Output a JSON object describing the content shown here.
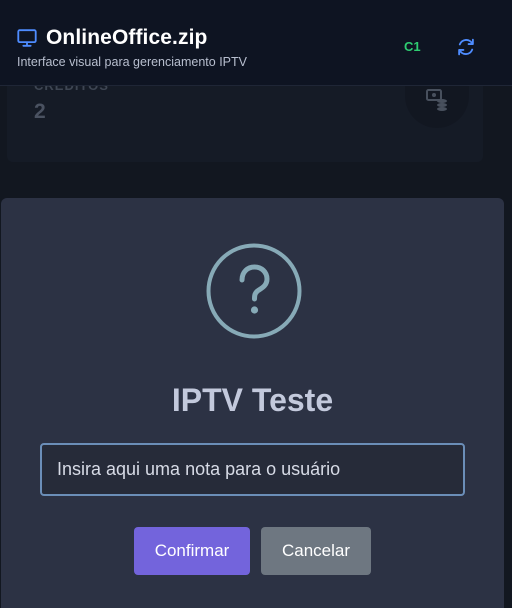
{
  "header": {
    "title": "OnlineOffice.zip",
    "subtitle": "Interface visual para gerenciamento IPTV",
    "server_badge": "C1",
    "icons": {
      "brand": "monitor-icon",
      "refresh": "refresh-icon"
    },
    "colors": {
      "background": "#0e1422",
      "badge": "#2ecc71",
      "refresh": "#4e8cff"
    }
  },
  "stat_card": {
    "label": "CRÉDITOS",
    "value": "2",
    "icon": "coins-icon"
  },
  "modal": {
    "icon": "question-icon",
    "title": "IPTV Teste",
    "input": {
      "value": "",
      "placeholder": "Insira aqui uma nota para o usuário"
    },
    "confirm_label": "Confirmar",
    "cancel_label": "Cancelar",
    "colors": {
      "confirm": "#7364dc",
      "cancel": "#6e7781",
      "icon": "#87aab7"
    }
  }
}
